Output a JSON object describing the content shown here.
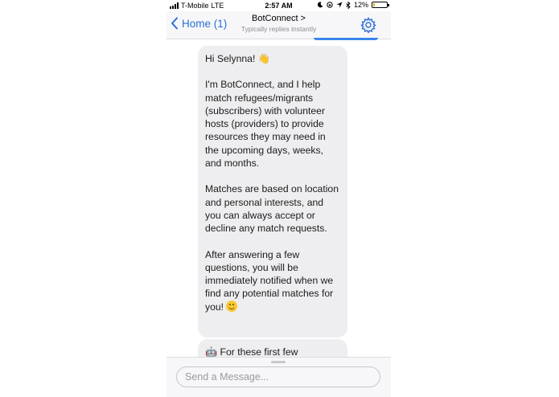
{
  "status_bar": {
    "carrier": "T-Mobile",
    "network": "LTE",
    "time": "2:57 AM",
    "battery": "12%",
    "battery_level": 0.12,
    "icons": [
      "moon-icon",
      "rotation-lock-icon",
      "location-icon",
      "bluetooth-icon"
    ]
  },
  "nav": {
    "back_label": "Home (1)",
    "title": "BotConnect >",
    "subtitle": "Typically replies instantly",
    "accent_color": "#2b6fd6"
  },
  "messages": [
    {
      "paragraphs": [
        "Hi Selynna! 👋",
        "I'm BotConnect, and I help match refugees/migrants (subscribers) with volunteer hosts (providers) to provide resources they may need in the upcoming days, weeks, and months.",
        "Matches are based on location and personal interests, and you can always accept or decline any match requests.",
        "After answering a few questions, you will be immediately notified when we find any potential matches for you!"
      ],
      "trailing_emoji": "smiling-face-icon"
    },
    {
      "paragraphs": [
        "🤖 For these first few"
      ]
    }
  ],
  "composer": {
    "placeholder": "Send a Message..."
  }
}
